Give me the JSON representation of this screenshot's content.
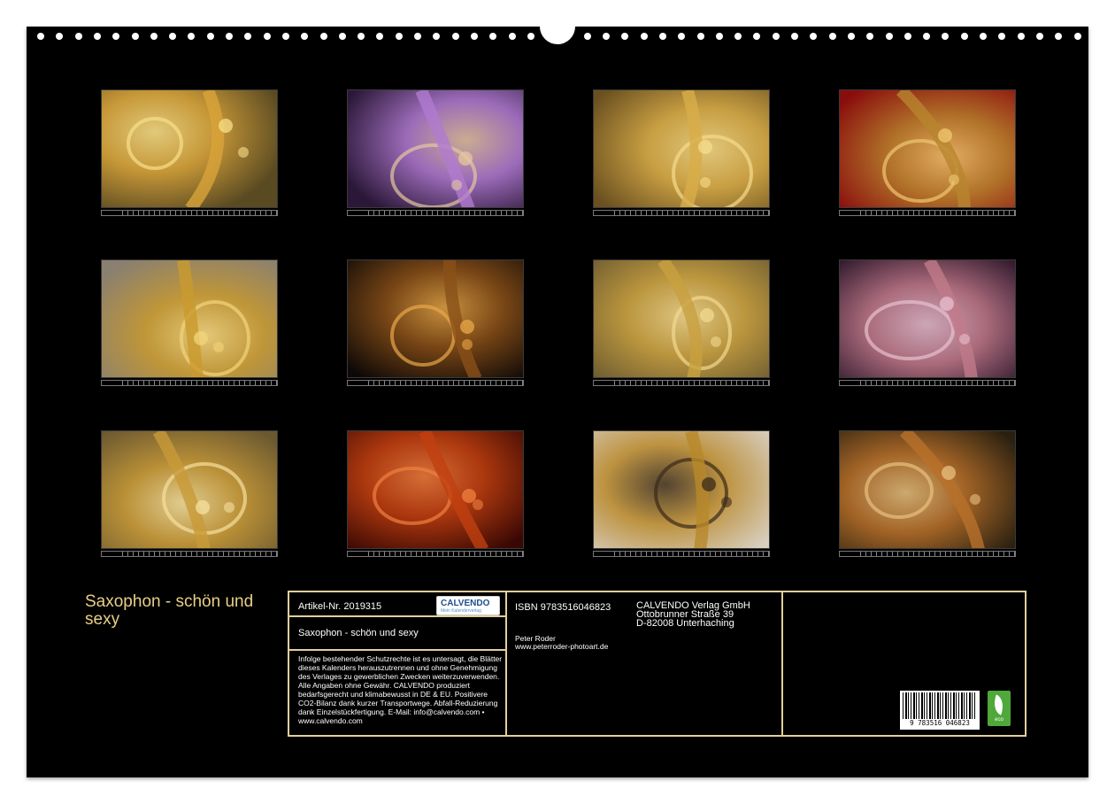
{
  "title": "Saxophon - schön und sexy",
  "photos": [
    {
      "name": "photo-january",
      "bg": "#5a4a22",
      "accent": "#d9a43a",
      "highlight": "#f8e08a"
    },
    {
      "name": "photo-february",
      "bg": "#2b1838",
      "accent": "#b07ad0",
      "highlight": "#e6c6a0"
    },
    {
      "name": "photo-march",
      "bg": "#6a5020",
      "accent": "#d8ac48",
      "highlight": "#f5dc8c"
    },
    {
      "name": "photo-april",
      "bg": "#8a0d0d",
      "accent": "#b8842e",
      "highlight": "#f0c870"
    },
    {
      "name": "photo-may",
      "bg": "#8a8070",
      "accent": "#c99a2e",
      "highlight": "#f3d47a"
    },
    {
      "name": "photo-june",
      "bg": "#0d0806",
      "accent": "#8a5018",
      "highlight": "#e8a848"
    },
    {
      "name": "photo-july",
      "bg": "#6b5a30",
      "accent": "#c8a040",
      "highlight": "#f2d890"
    },
    {
      "name": "photo-august",
      "bg": "#2a1428",
      "accent": "#c07a8a",
      "highlight": "#e8c0d0"
    },
    {
      "name": "photo-september",
      "bg": "#6a5830",
      "accent": "#c89a38",
      "highlight": "#f5e0a0"
    },
    {
      "name": "photo-october",
      "bg": "#3a0804",
      "accent": "#c04010",
      "highlight": "#f08040"
    },
    {
      "name": "photo-november",
      "bg": "#d8cfc0",
      "accent": "#b8882a",
      "highlight": "#3a2a18"
    },
    {
      "name": "photo-december",
      "bg": "#2a2010",
      "accent": "#b8702a",
      "highlight": "#e8c080"
    }
  ],
  "info": {
    "article_no": "Artikel-Nr. 2019315",
    "logo_brand": "CALVENDO",
    "logo_sub": "Mein Kalenderverlag",
    "product_title": "Saxophon - schön und sexy",
    "legal_text": "Infolge bestehender Schutzrechte ist es untersagt, die Blätter dieses Kalenders herauszutrennen und ohne Genehmigung des Verlages zu gewerblichen Zwecken weiterzuverwenden. Alle Angaben ohne Gewähr. CALVENDO produziert bedarfsgerecht und klimabewusst in DE & EU. Positivere CO2-Bilanz dank kurzer Transportwege. Abfall-Reduzierung dank Einzelstückfertigung. E-Mail: info@calvendo.com • www.calvendo.com",
    "isbn": "ISBN 9783516046823",
    "author": "Peter Roder",
    "website": "www.peterroder-photoart.de",
    "publisher_name": "CALVENDO Verlag GmbH",
    "publisher_street": "Ottobrunner Straße 39",
    "publisher_city": "D-82008 Unterhaching",
    "barcode_number": "9 783516 046823",
    "eco_label": "eco"
  },
  "colors": {
    "gold": "#e9cf84",
    "frame": "#e1cf9c",
    "background": "#000000"
  }
}
